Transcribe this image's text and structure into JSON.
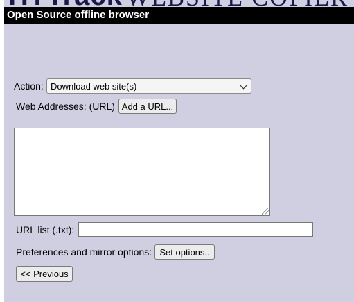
{
  "banner": {
    "logo_text": "HTTrack",
    "subtitle": "WEBSITE COPIER"
  },
  "title_bar": {
    "text": "Open Source offline browser"
  },
  "form": {
    "action_label": "Action:",
    "action_selected": "Download web site(s)",
    "web_addresses_label": "Web Addresses: (URL)",
    "add_url_button": "Add a URL...",
    "url_textarea_value": "",
    "url_list_label": "URL list (.txt):",
    "url_list_value": "",
    "preferences_label": "Preferences and mirror options:",
    "set_options_button": "Set options..",
    "previous_button": "<< Previous"
  },
  "colors": {
    "page_background": "#cfcfe1",
    "title_bar_background": "#000000",
    "title_bar_text": "#ffffff"
  }
}
